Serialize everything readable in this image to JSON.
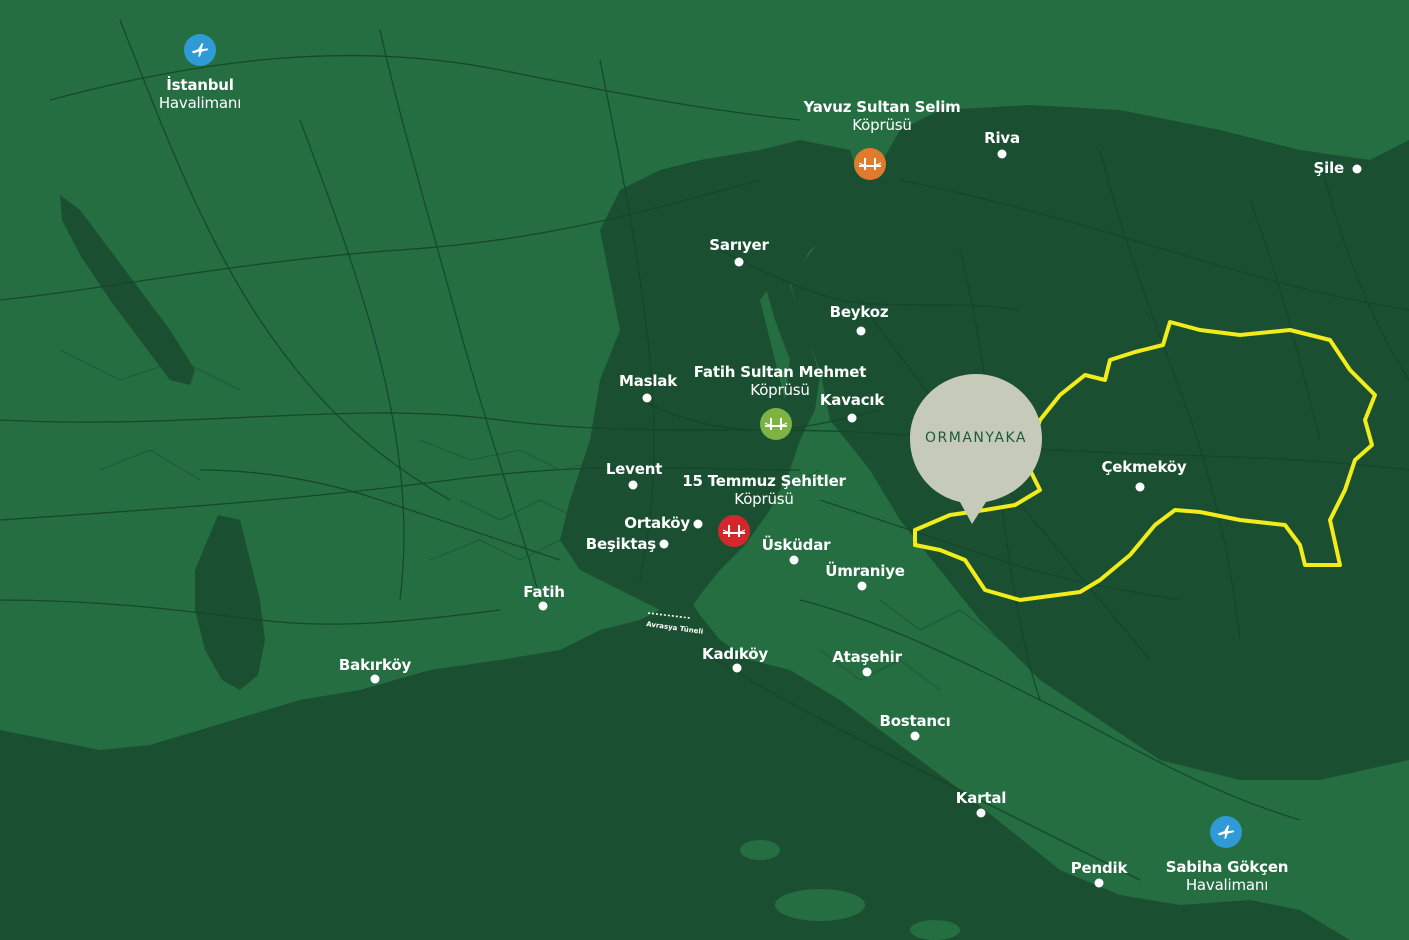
{
  "colors": {
    "land": "#246e42",
    "sea": "#1b4f31",
    "roads": "#15452a",
    "district_outline": "#f2ec1a",
    "pin": "#c5cbb8",
    "airport": "#2f9ad6",
    "bridge_yavuz": "#e07a2c",
    "bridge_fsm": "#7cb342",
    "bridge_15temmuz": "#d3262d"
  },
  "airports": [
    {
      "id": "istanbul",
      "name": "İstanbul",
      "sub": "Havalimanı",
      "icon": "airplane-icon"
    },
    {
      "id": "sabiha",
      "name": "Sabiha Gökçen",
      "sub": "Havalimanı",
      "icon": "airplane-icon"
    }
  ],
  "bridges": [
    {
      "id": "yavuz",
      "name": "Yavuz Sultan Selim",
      "sub": "Köprüsü",
      "icon": "bridge-icon"
    },
    {
      "id": "fsm",
      "name": "Fatih Sultan Mehmet",
      "sub": "Köprüsü",
      "icon": "bridge-icon"
    },
    {
      "id": "temmuz",
      "name": "15 Temmuz Şehitler",
      "sub": "Köprüsü",
      "icon": "bridge-icon"
    }
  ],
  "places": {
    "riva": "Riva",
    "sile": "Şile",
    "sariyer": "Sarıyer",
    "beykoz": "Beykoz",
    "maslak": "Maslak",
    "kavacik": "Kavacık",
    "levent": "Levent",
    "ortakoy": "Ortaköy",
    "besiktas": "Beşiktaş",
    "uskudar": "Üsküdar",
    "umraniye": "Ümraniye",
    "fatih": "Fatih",
    "bakirkoy": "Bakırköy",
    "kadikoy": "Kadıköy",
    "atasehir": "Ataşehir",
    "bostanci": "Bostancı",
    "kartal": "Kartal",
    "pendik": "Pendik",
    "cekmekoy": "Çekmeköy"
  },
  "tunnel": "Avrasya Tüneli",
  "project": {
    "name": "ORMANYAKA"
  }
}
